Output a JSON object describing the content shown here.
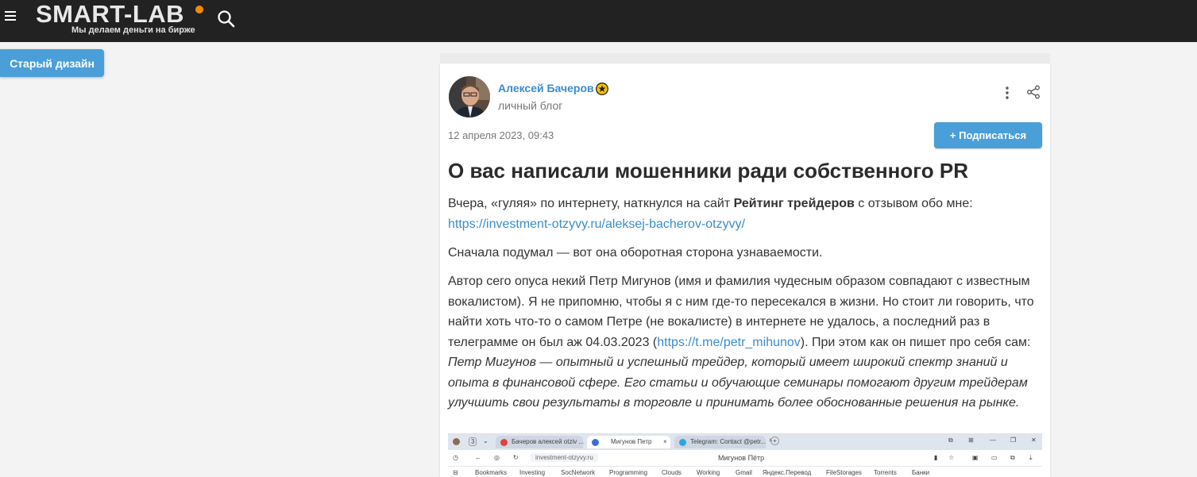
{
  "header": {
    "logo_text": "SMART-LAB",
    "logo_tagline": "Мы делаем деньги на бирже",
    "accent_color": "#f08a00",
    "menu_icon": "hamburger-icon",
    "search_icon": "search-icon"
  },
  "old_design_button": "Старый дизайн",
  "post": {
    "author": "Алексей Бачеров",
    "blog_type": "личный блог",
    "date": "12 апреля 2023, 09:43",
    "subscribe_label": "+ Подписаться",
    "title": "О вас написали мошенники ради собственного PR",
    "p1_a": "Вчера, «гуляя» по интернету, наткнулся на сайт ",
    "p1_bold": "Рейтинг трейдеров",
    "p1_b": " с отзывом обо мне: ",
    "p1_link": "https://investment-otzyvy.ru/aleksej-bacherov-otzyvy/",
    "p2": "Сначала подумал — вот она оборотная сторона узнаваемости.",
    "p3_a": "Автор сего опуса некий Петр Мигунов (имя и фамилия чудесным образом совпадают с известным вокалистом). Я не припомню, чтобы я с ним где-то пересекался в жизни. Но стоит ли говорить, что найти хоть что-то о самом Петре (не вокалисте) в интернете не удалось, а последний раз в телеграмме он был аж 04.03.2023 (",
    "p3_link": "https://t.me/petr_mihunov",
    "p3_b": "). При этом как он пишет про себя сам: ",
    "p3_italic": "Петр Мигунов — опытный и успешный трейдер, который имеет широкий спектр знаний и опыта в финансовой сфере. Его статьи и обучающие семинары помогают другим трейдерам улучшить свои результаты в торговле и принимать более обоснованные решения на рынке."
  },
  "embedded_screenshot": {
    "tabs": [
      "Бачеров алексей otziv ...",
      "Мигунов Петр",
      "Telegram: Contact @petr..."
    ],
    "tab_count": "3",
    "address": "investment-otzyvy.ru",
    "page_title": "Мигунов Пётр",
    "bookmarks": [
      "Bookmarks",
      "Investing",
      "SocNetwork",
      "Programming",
      "Clouds",
      "Working",
      "Gmail",
      "Яндекс.Перевод",
      "FileStorages",
      "Torrents",
      "Банки"
    ]
  }
}
